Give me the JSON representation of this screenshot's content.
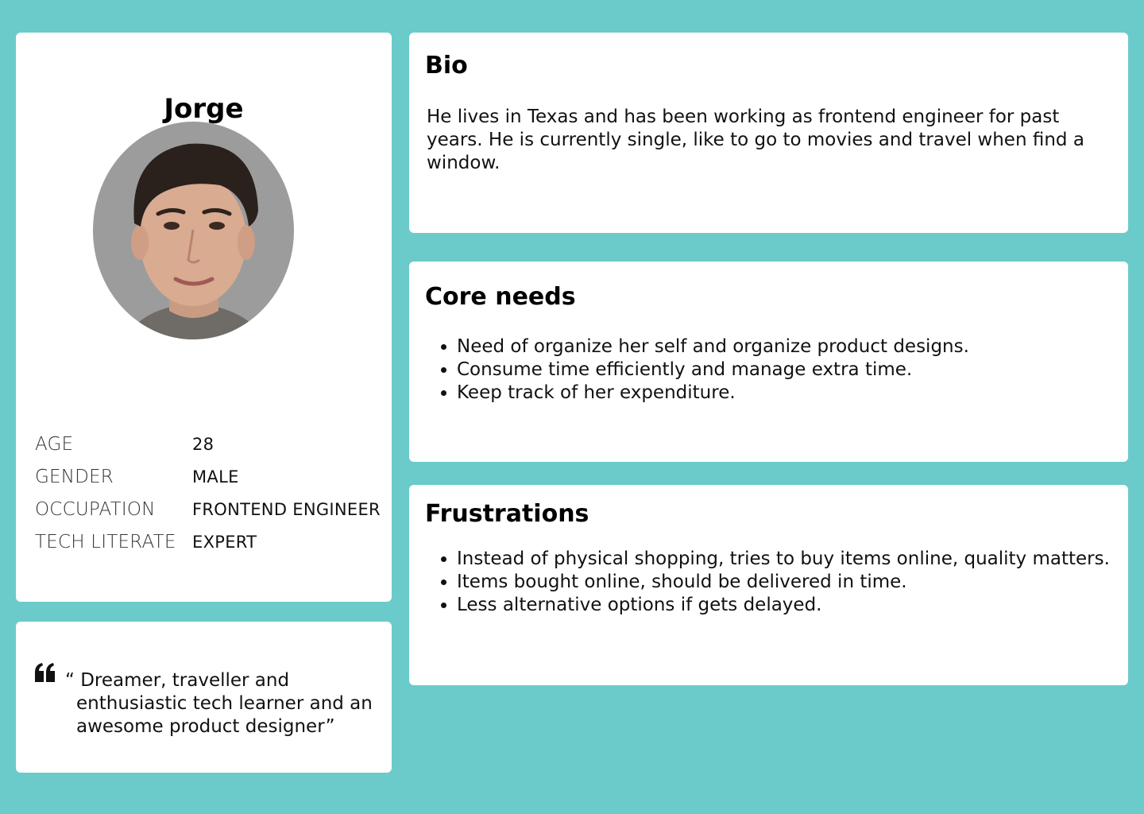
{
  "profile": {
    "name": "Jorge",
    "avatar_icon": "person-photo-icon",
    "attributes": [
      {
        "label": "AGE",
        "value": "28"
      },
      {
        "label": "GENDER",
        "value": "MALE"
      },
      {
        "label": "OCCUPATION",
        "value": "FRONTEND ENGINEER"
      },
      {
        "label": "TECH LITERATE",
        "value": "EXPERT"
      }
    ]
  },
  "quote": {
    "icon": "quote-marks-icon",
    "line1": "“ Dreamer, traveller and",
    "line2": "enthusiastic tech learner and an",
    "line3": "awesome product designer”"
  },
  "bio": {
    "title": "Bio",
    "text": "He lives in Texas and has been working as frontend engineer for past years. He is currently single, like to go to movies and travel when find a window."
  },
  "core_needs": {
    "title": "Core needs",
    "items": [
      "Need of organize her self and organize product  designs.",
      "Consume time efficiently and manage extra time.",
      "Keep track of her expenditure."
    ]
  },
  "frustrations": {
    "title": "Frustrations",
    "items": [
      "Instead of physical shopping, tries to buy items online, quality matters.",
      "Items bought online, should be delivered in time.",
      "Less alternative options if gets delayed."
    ]
  },
  "colors": {
    "background": "#6acbca",
    "card": "#ffffff"
  }
}
